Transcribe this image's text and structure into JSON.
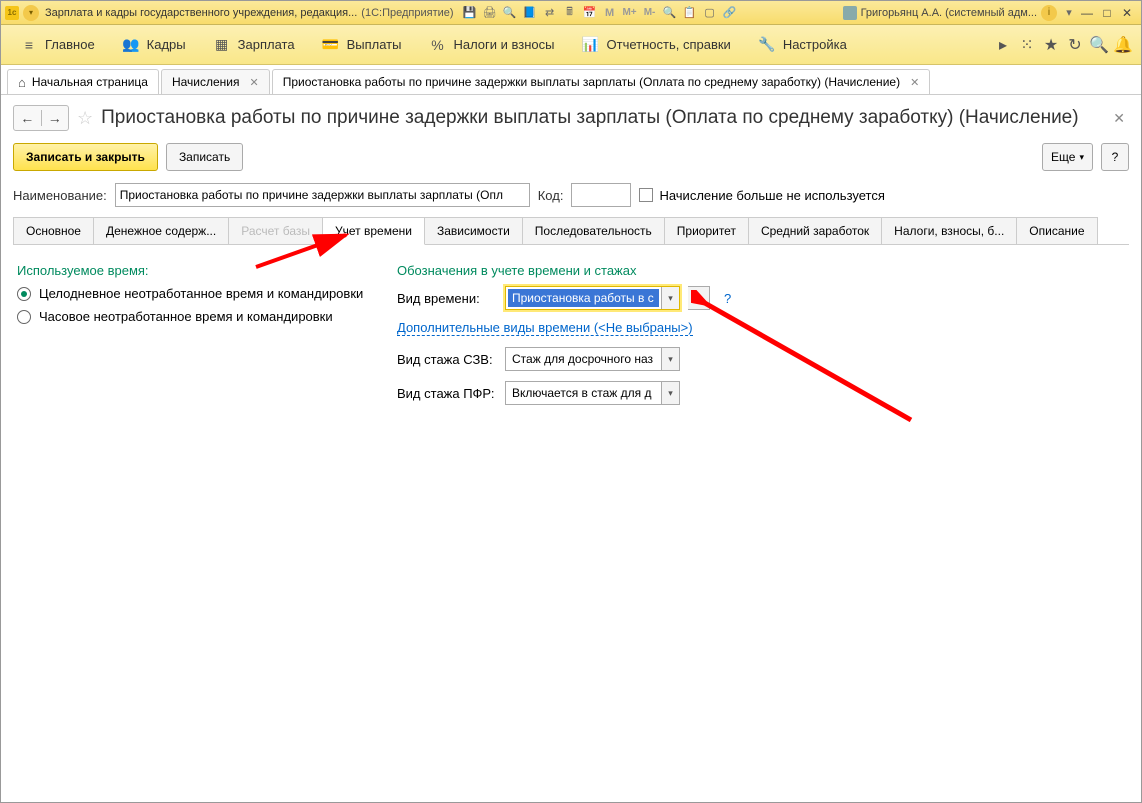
{
  "titlebar": {
    "app_title": "Зарплата и кадры государственного учреждения, редакция...",
    "suffix": "(1С:Предприятие)",
    "user_name": "Григорьянц А.А. (системный адм..."
  },
  "mainnav": {
    "items": [
      {
        "icon": "≡",
        "label": "Главное"
      },
      {
        "icon": "👥",
        "label": "Кадры"
      },
      {
        "icon": "▦",
        "label": "Зарплата"
      },
      {
        "icon": "💳",
        "label": "Выплаты"
      },
      {
        "icon": "%",
        "label": "Налоги и взносы"
      },
      {
        "icon": "📊",
        "label": "Отчетность, справки"
      },
      {
        "icon": "🔧",
        "label": "Настройка"
      }
    ]
  },
  "tabs": [
    {
      "label": "Начальная страница",
      "home": true,
      "closable": false
    },
    {
      "label": "Начисления",
      "closable": true
    },
    {
      "label": "Приостановка работы по причине задержки выплаты зарплаты (Оплата по среднему заработку) (Начисление)",
      "closable": true,
      "active": true
    }
  ],
  "page": {
    "title": "Приостановка работы по причине задержки выплаты зарплаты (Оплата по среднему заработку) (Начисление)"
  },
  "toolbar": {
    "save_close": "Записать и закрыть",
    "save": "Записать",
    "more": "Еще",
    "help": "?"
  },
  "form": {
    "name_label": "Наименование:",
    "name_value": "Приостановка работы по причине задержки выплаты зарплаты (Опл",
    "code_label": "Код:",
    "code_value": "",
    "unused_label": "Начисление больше не используется"
  },
  "inner_tabs": [
    "Основное",
    "Денежное содерж...",
    "Расчет базы",
    "Учет времени",
    "Зависимости",
    "Последовательность",
    "Приоритет",
    "Средний заработок",
    "Налоги, взносы, б...",
    "Описание"
  ],
  "time_tab": {
    "left_title": "Используемое время:",
    "radio1": "Целодневное неотработанное время и командировки",
    "radio2": "Часовое неотработанное время и командировки",
    "right_title": "Обозначения в учете времени и стажах",
    "kind_label": "Вид времени:",
    "kind_value": "Приостановка работы в с",
    "addkinds_link": "Дополнительные виды времени (<Не выбраны>)",
    "szv_label": "Вид стажа СЗВ:",
    "szv_value": "Стаж для досрочного наз",
    "pfr_label": "Вид стажа ПФР:",
    "pfr_value": "Включается в стаж для д"
  }
}
